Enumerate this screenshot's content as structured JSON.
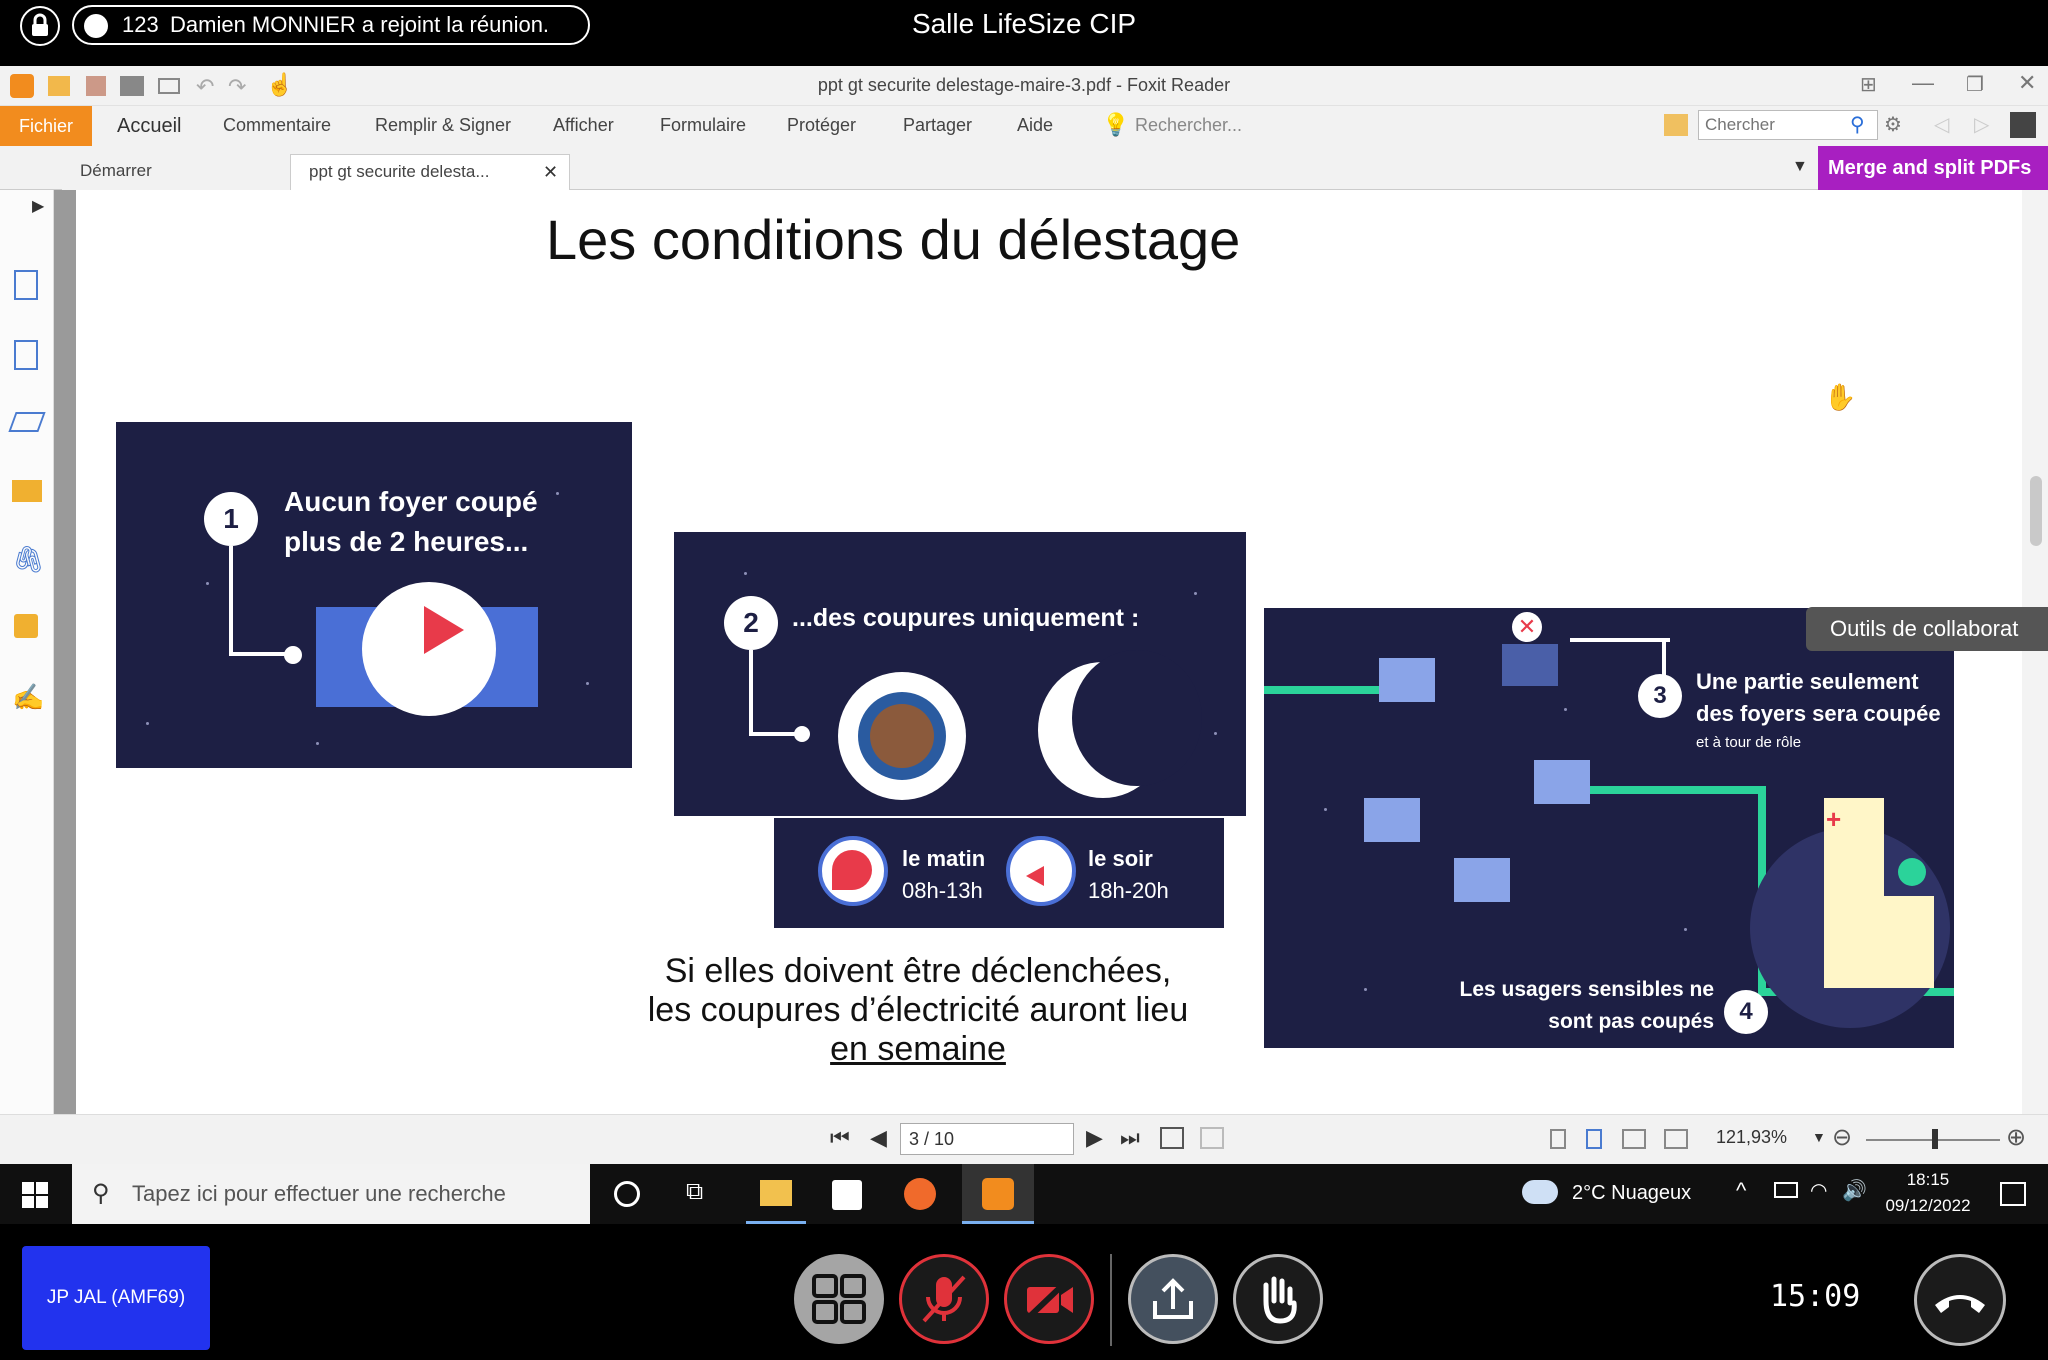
{
  "meeting": {
    "participants_count": "123",
    "notification": "Damien MONNIER a rejoint la réunion.",
    "room_name": "Salle LifeSize CIP",
    "user_label": "JP JAL (AMF69)",
    "clock": "15:09"
  },
  "app": {
    "window_title": "ppt gt securite delestage-maire-3.pdf - Foxit Reader",
    "menu": [
      "Fichier",
      "Accueil",
      "Commentaire",
      "Remplir & Signer",
      "Afficher",
      "Formulaire",
      "Protéger",
      "Partager",
      "Aide"
    ],
    "rechercher_label": "Rechercher...",
    "search_placeholder": "Chercher",
    "tabs": [
      {
        "label": "Démarrer"
      },
      {
        "label": "ppt gt securite delesta..."
      }
    ],
    "merge_button": "Merge and split PDFs",
    "collab_button": "Outils de collaborat",
    "page_indicator": "3 / 10",
    "zoom": "121,93%"
  },
  "slide": {
    "title": "Les conditions du délestage",
    "panel1_text": "Aucun foyer coupé plus de 2 heures...",
    "panel1_num": "1",
    "panel2_text": "...des coupures uniquement :",
    "panel2_num": "2",
    "matin_label": "le matin",
    "matin_hours": "08h-13h",
    "soir_label": "le soir",
    "soir_hours": "18h-20h",
    "caption_line1": "Si elles doivent être déclenchées,",
    "caption_line2": "les coupures d’électricité auront lieu",
    "caption_line3": "en semaine",
    "panel3_num": "3",
    "panel3_text": "Une partie seulement des foyers sera coupée",
    "panel3_sub": "et à tour de rôle",
    "panel4_num": "4",
    "panel4_text": "Les usagers sensibles ne sont pas coupés"
  },
  "taskbar": {
    "search_placeholder": "Tapez ici pour effectuer une recherche",
    "weather": "2°C Nuageux",
    "time": "18:15",
    "date": "09/12/2022"
  },
  "colors": {
    "foxit_orange": "#f28c1e",
    "merge_purple": "#a81fc1",
    "panel_navy": "#1d1f44",
    "user_tile_blue": "#2233ee",
    "mute_red": "#e0323a"
  }
}
